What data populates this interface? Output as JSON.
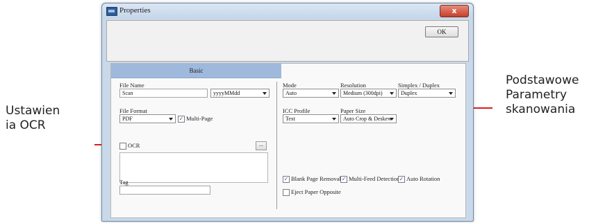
{
  "annotations": {
    "left": [
      "Ustawien",
      "ia OCR"
    ],
    "right": [
      "Podstawowe",
      "Parametry",
      "skanowania"
    ]
  },
  "window": {
    "title": "Properties",
    "close_glyph": "x",
    "ok_label": "OK"
  },
  "tabs": {
    "basic": "Basic"
  },
  "left": {
    "file_name_label": "File Name",
    "file_name_value": "Scan",
    "date_format": "yyyyMMdd",
    "file_format_label": "File Format",
    "file_format_value": "PDF",
    "multi_page_label": "Multi-Page",
    "ocr_label": "OCR",
    "ocr_button": "...",
    "tag_label": "Tag",
    "tag_value": ""
  },
  "right": {
    "mode_label": "Mode",
    "mode_value": "Auto",
    "resolution_label": "Resolution",
    "resolution_value": "Medium (300dpi)",
    "duplex_label": "Simplex / Duplex",
    "duplex_value": "Duplex",
    "icc_label": "ICC Profile",
    "icc_value": "Text",
    "paper_size_label": "Paper Size",
    "paper_size_value": "Auto Crop & Deskew",
    "blank_page_label": "Blank Page Removal",
    "multi_feed_label": "Multi-Feed Detection",
    "auto_rotation_label": "Auto Rotation",
    "eject_paper_label": "Eject Paper Opposite"
  },
  "checks": {
    "checked": "✓",
    "unchecked": ""
  },
  "colors": {
    "annotation_line": "#d81e1e",
    "tab_active": "#9fb9dc",
    "window_frame": "#c9d9ea"
  }
}
